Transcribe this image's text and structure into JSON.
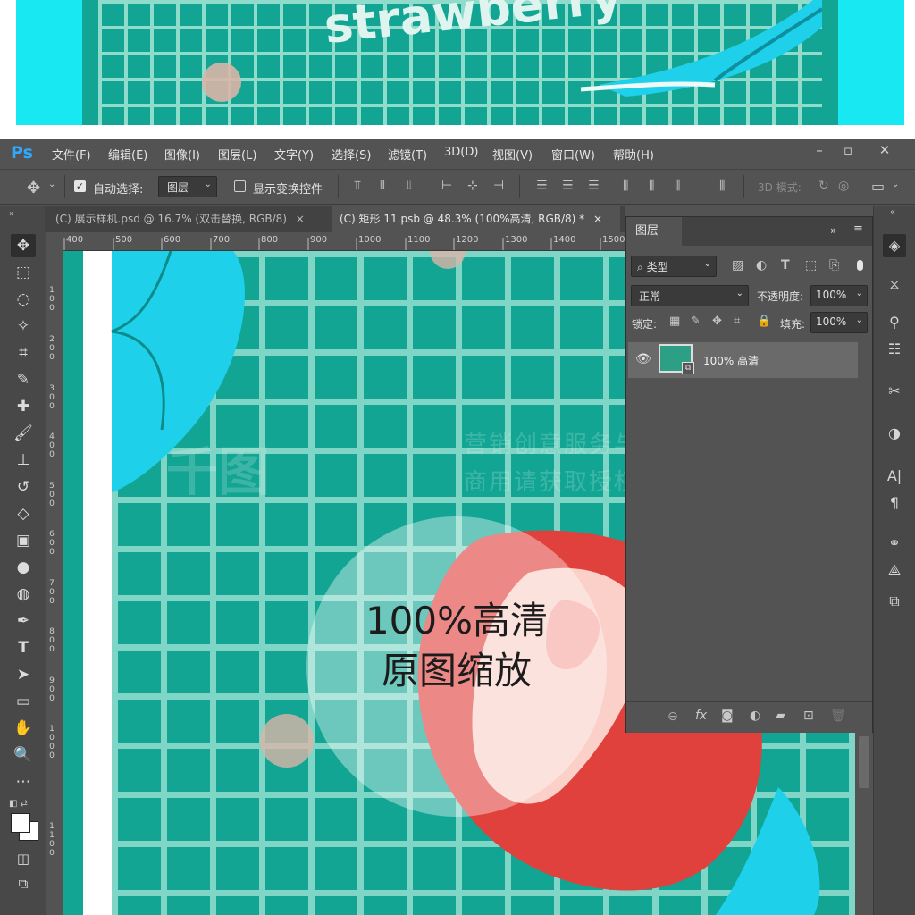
{
  "preview": {
    "title_text": "strawberry"
  },
  "app": {
    "logo": "Ps",
    "menu": [
      "文件(F)",
      "编辑(E)",
      "图像(I)",
      "图层(L)",
      "文字(Y)",
      "选择(S)",
      "滤镜(T)",
      "3D(D)",
      "视图(V)",
      "窗口(W)",
      "帮助(H)"
    ],
    "window_controls": {
      "minimize": "–",
      "maximize": "▫",
      "close": "✕"
    }
  },
  "options_bar": {
    "auto_select_label": "自动选择:",
    "auto_select_checked": true,
    "auto_select_value": "图层",
    "show_transform_label": "显示变换控件",
    "show_transform_checked": false,
    "mode_3d_label": "3D 模式:"
  },
  "tabs": [
    {
      "label": "(C) 展示样机.psd @ 16.7% (双击替换, RGB/8)",
      "close": "×",
      "active": false
    },
    {
      "label": "(C) 矩形 11.psb @ 48.3% (100%高清, RGB/8) *",
      "close": "×",
      "active": true
    }
  ],
  "ruler_top": [
    "400",
    "500",
    "600",
    "700",
    "800",
    "900",
    "1000",
    "1100",
    "1200",
    "1300",
    "1400",
    "1500"
  ],
  "ruler_left": [
    "1\n0\n0",
    "2\n0\n0",
    "3\n0\n0",
    "4\n0\n0",
    "5\n0\n0",
    "6\n0\n0",
    "7\n0\n0",
    "8\n0\n0",
    "9\n0\n0",
    "1\n0\n0\n0",
    "1\n1\n0\n0"
  ],
  "canvas": {
    "overlay_line1": "100%高清",
    "overlay_line2": "原图缩放",
    "watermark_line1": "营销创意服务与协作平台",
    "watermark_line2": "商用请获取授权",
    "watermark_logo": "千图"
  },
  "layers_panel": {
    "title": "图层",
    "filter_label": "类型",
    "blend_mode": "正常",
    "opacity_label": "不透明度:",
    "opacity_value": "100%",
    "lock_label": "锁定:",
    "fill_label": "填充:",
    "fill_value": "100%",
    "layers": [
      {
        "name": "100% 高清",
        "visible": true
      }
    ],
    "bottom_icons": [
      "link-icon",
      "fx-icon",
      "mask-icon",
      "adjustment-icon",
      "folder-icon",
      "new-layer-icon",
      "trash-icon"
    ]
  },
  "colors": {
    "teal": "#12a593",
    "grid_line": "#7fd6c6",
    "cyan": "#18e8f2",
    "strawberry": "#e0413d",
    "ps_panel": "#535353",
    "ps_accent": "#31a8ff"
  }
}
